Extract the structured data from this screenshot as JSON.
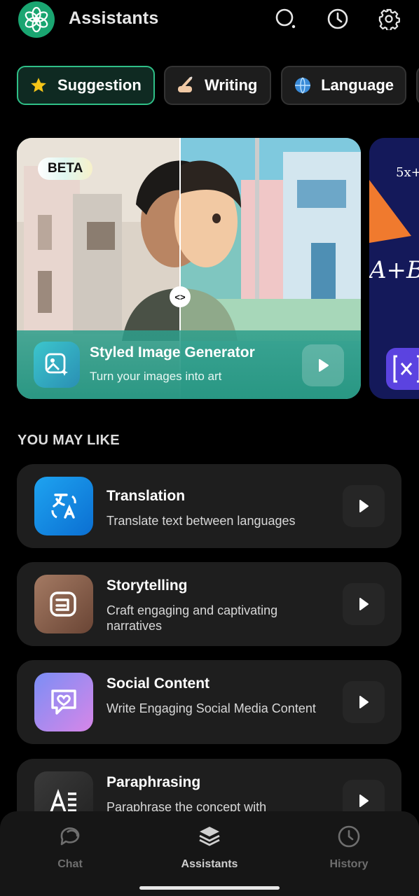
{
  "header": {
    "title": "Assistants",
    "icons": [
      "search-icon",
      "history-icon",
      "settings-icon"
    ]
  },
  "chips": [
    {
      "label": "Suggestion",
      "icon": "star-icon",
      "active": true
    },
    {
      "label": "Writing",
      "icon": "writing-hand-icon",
      "active": false
    },
    {
      "label": "Language",
      "icon": "globe-icon",
      "active": false
    }
  ],
  "featured": {
    "badge": "BETA",
    "title": "Styled Image Generator",
    "subtitle": "Turn your images into art",
    "peek_text": "A+B"
  },
  "section": {
    "title": "YOU MAY LIKE"
  },
  "list": [
    {
      "title": "Translation",
      "subtitle": "Translate text between languages",
      "icon": "translate-icon"
    },
    {
      "title": "Storytelling",
      "subtitle": "Craft engaging and captivating narratives",
      "icon": "story-icon"
    },
    {
      "title": "Social Content",
      "subtitle": "Write Engaging Social Media Content",
      "icon": "heart-chat-icon"
    },
    {
      "title": "Paraphrasing",
      "subtitle": "Paraphrase the concept with",
      "icon": "paraphrase-icon"
    }
  ],
  "nav": [
    {
      "label": "Chat",
      "icon": "chat-icon",
      "active": false
    },
    {
      "label": "Assistants",
      "icon": "stack-icon",
      "active": true
    },
    {
      "label": "History",
      "icon": "clock-icon",
      "active": false
    }
  ],
  "colors": {
    "accent": "#2fbf87",
    "background": "#000000",
    "card": "#1e1e1e"
  }
}
